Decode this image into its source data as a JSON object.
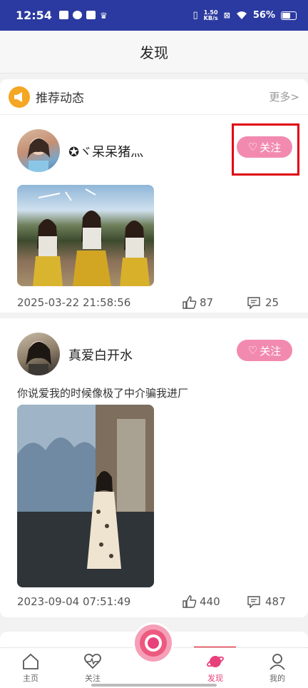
{
  "status_bar": {
    "time": "12:54",
    "speed_value": "1.50",
    "speed_unit": "KB/s",
    "battery": "56%"
  },
  "titlebar": {
    "title": "发现"
  },
  "recommend": {
    "title": "推荐动态",
    "more": "更多>"
  },
  "posts": [
    {
      "username": "✪ヾ呆呆猪灬",
      "follow": "关注",
      "date": "2025-03-22 21:58:56",
      "likes": "87",
      "comments": "25",
      "text": ""
    },
    {
      "username": "真爱白开水",
      "follow": "关注",
      "date": "2023-09-04 07:51:49",
      "likes": "440",
      "comments": "487",
      "text": "你说爱我的时候像极了中介骗我进厂"
    }
  ],
  "tabs": [
    {
      "label": "主页",
      "icon": "home-icon"
    },
    {
      "label": "关注",
      "icon": "heart-pulse-icon"
    },
    {
      "label": "发现",
      "icon": "planet-icon",
      "active": true
    },
    {
      "label": "我的",
      "icon": "user-icon"
    }
  ],
  "colors": {
    "status_bar": "#2b3aa0",
    "follow_button": "#f28ab0",
    "active_tab": "#e8407a",
    "highlight_box": "#e00010"
  }
}
